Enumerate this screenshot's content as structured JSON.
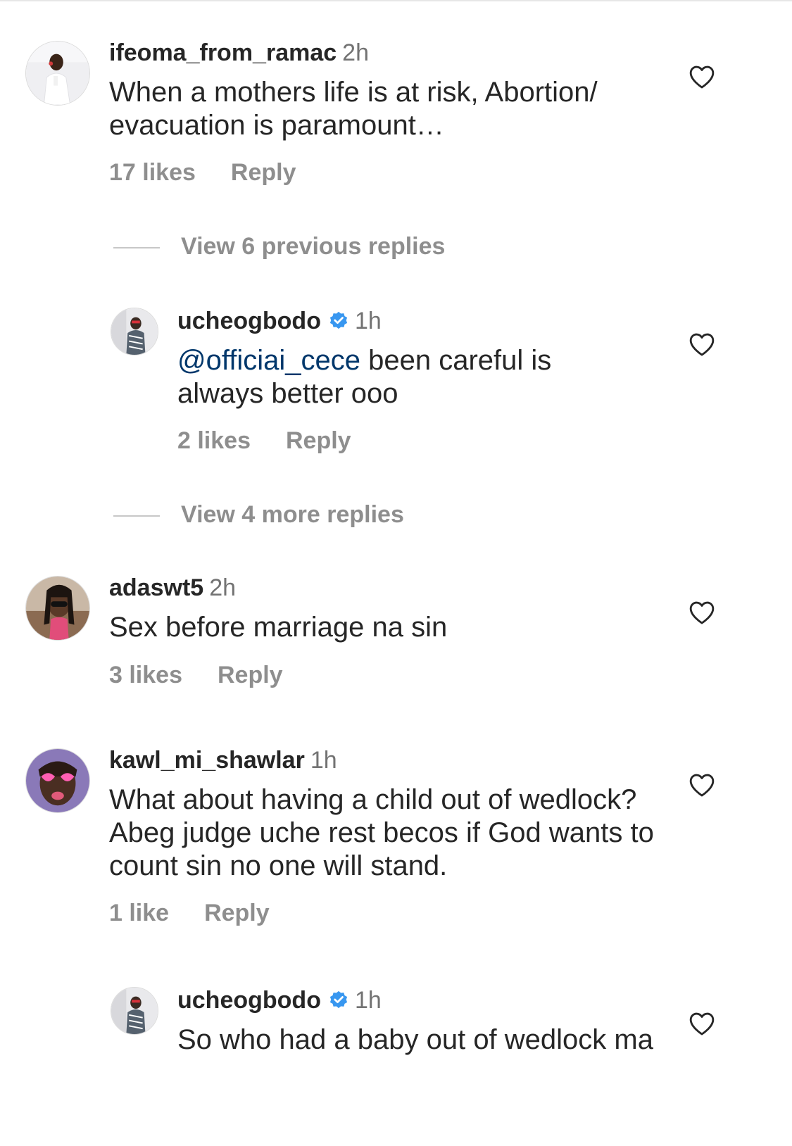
{
  "comments": [
    {
      "username": "ifeoma_from_ramac",
      "time": "2h",
      "text": "When a mothers life is at risk, Abortion/ evacuation is paramount…",
      "likes": "17 likes",
      "reply": "Reply"
    },
    {
      "username": "ucheogbodo",
      "verified": true,
      "time": "1h",
      "mention": "@officiai_cece",
      "text": " been careful is always better ooo",
      "likes": "2 likes",
      "reply": "Reply"
    },
    {
      "username": "adaswt5",
      "time": "2h",
      "text": "Sex before marriage na sin",
      "likes": "3 likes",
      "reply": "Reply"
    },
    {
      "username": "kawl_mi_shawlar",
      "time": "1h",
      "text": "What about having a child out of wedlock? Abeg judge uche rest becos if God wants to count sin no one will stand.",
      "likes": "1 like",
      "reply": "Reply"
    },
    {
      "username": "ucheogbodo",
      "verified": true,
      "time": "1h",
      "text": "So who had a baby out of wedlock ma"
    }
  ],
  "view_previous": "View 6 previous replies",
  "view_more": "View 4 more replies",
  "colors": {
    "text": "#262626",
    "secondary": "#8e8e8e",
    "mention": "#00376b",
    "verified": "#3897f0"
  },
  "icons": {
    "like": "heart-outline-icon",
    "verified": "verified-badge-icon"
  }
}
